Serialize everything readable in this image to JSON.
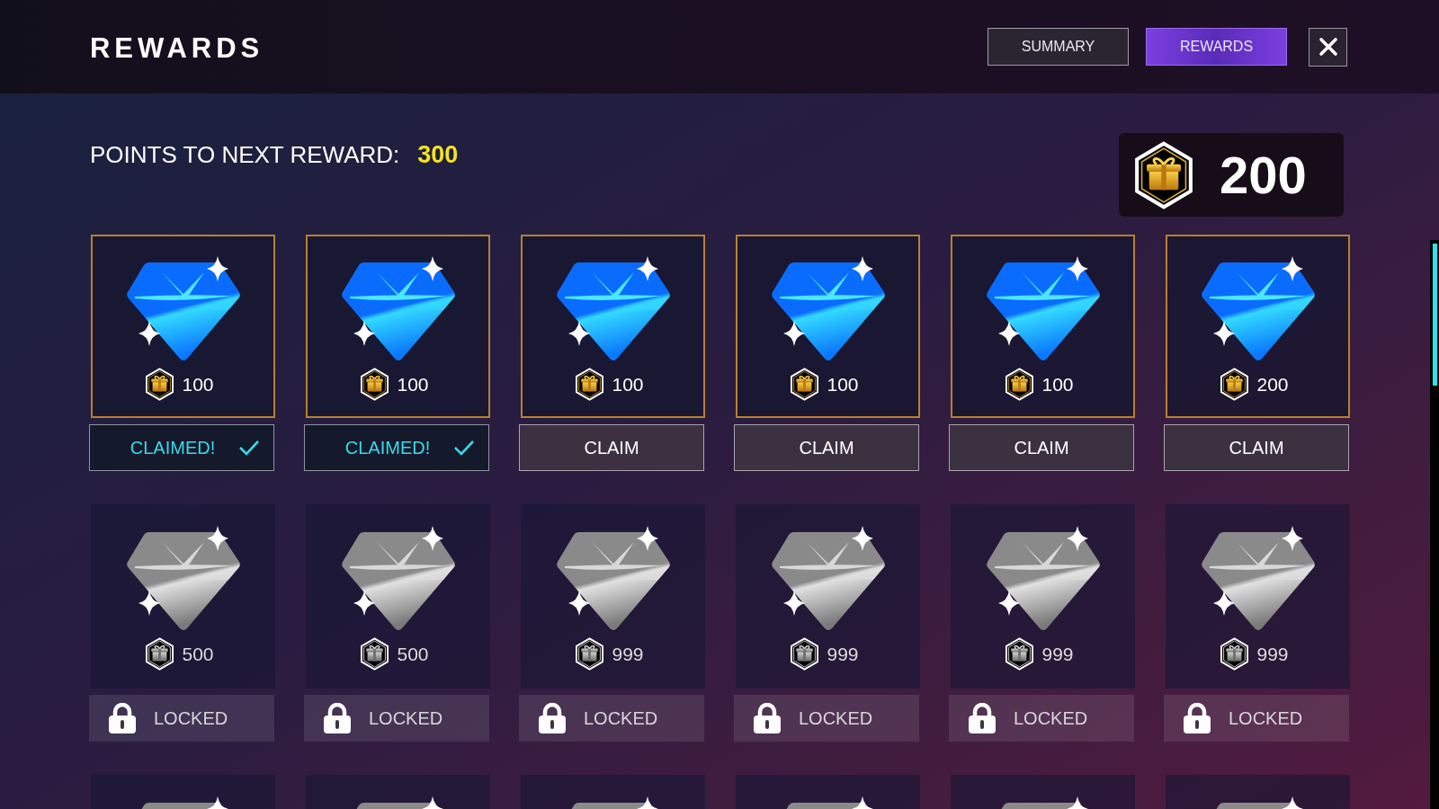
{
  "header": {
    "title": "REWARDS",
    "tabs": [
      {
        "label": "SUMMARY",
        "selected": false
      },
      {
        "label": "REWARDS",
        "selected": true
      }
    ]
  },
  "points": {
    "label": "POINTS TO NEXT REWARD:",
    "value": "300"
  },
  "balance": {
    "value": "200"
  },
  "rows": [
    {
      "cards": [
        {
          "kind": "blue",
          "cost": "100",
          "button": {
            "kind": "claimed",
            "label": "CLAIMED!"
          }
        },
        {
          "kind": "blue",
          "cost": "100",
          "button": {
            "kind": "claimed",
            "label": "CLAIMED!"
          }
        },
        {
          "kind": "blue",
          "cost": "100",
          "button": {
            "kind": "claim",
            "label": "CLAIM"
          }
        },
        {
          "kind": "blue",
          "cost": "100",
          "button": {
            "kind": "claim",
            "label": "CLAIM"
          }
        },
        {
          "kind": "blue",
          "cost": "100",
          "button": {
            "kind": "claim",
            "label": "CLAIM"
          }
        },
        {
          "kind": "blue",
          "cost": "200",
          "button": {
            "kind": "claim",
            "label": "CLAIM"
          }
        }
      ]
    },
    {
      "cards": [
        {
          "kind": "silver",
          "cost": "500",
          "button": {
            "kind": "locked",
            "label": "LOCKED"
          }
        },
        {
          "kind": "silver",
          "cost": "500",
          "button": {
            "kind": "locked",
            "label": "LOCKED"
          }
        },
        {
          "kind": "silver",
          "cost": "999",
          "button": {
            "kind": "locked",
            "label": "LOCKED"
          }
        },
        {
          "kind": "silver",
          "cost": "999",
          "button": {
            "kind": "locked",
            "label": "LOCKED"
          }
        },
        {
          "kind": "silver",
          "cost": "999",
          "button": {
            "kind": "locked",
            "label": "LOCKED"
          }
        },
        {
          "kind": "silver",
          "cost": "999",
          "button": {
            "kind": "locked",
            "label": "LOCKED"
          }
        }
      ]
    },
    {
      "cards": [
        {
          "kind": "silver"
        },
        {
          "kind": "silver"
        },
        {
          "kind": "silver"
        },
        {
          "kind": "silver"
        },
        {
          "kind": "silver"
        },
        {
          "kind": "silver"
        }
      ]
    }
  ]
}
